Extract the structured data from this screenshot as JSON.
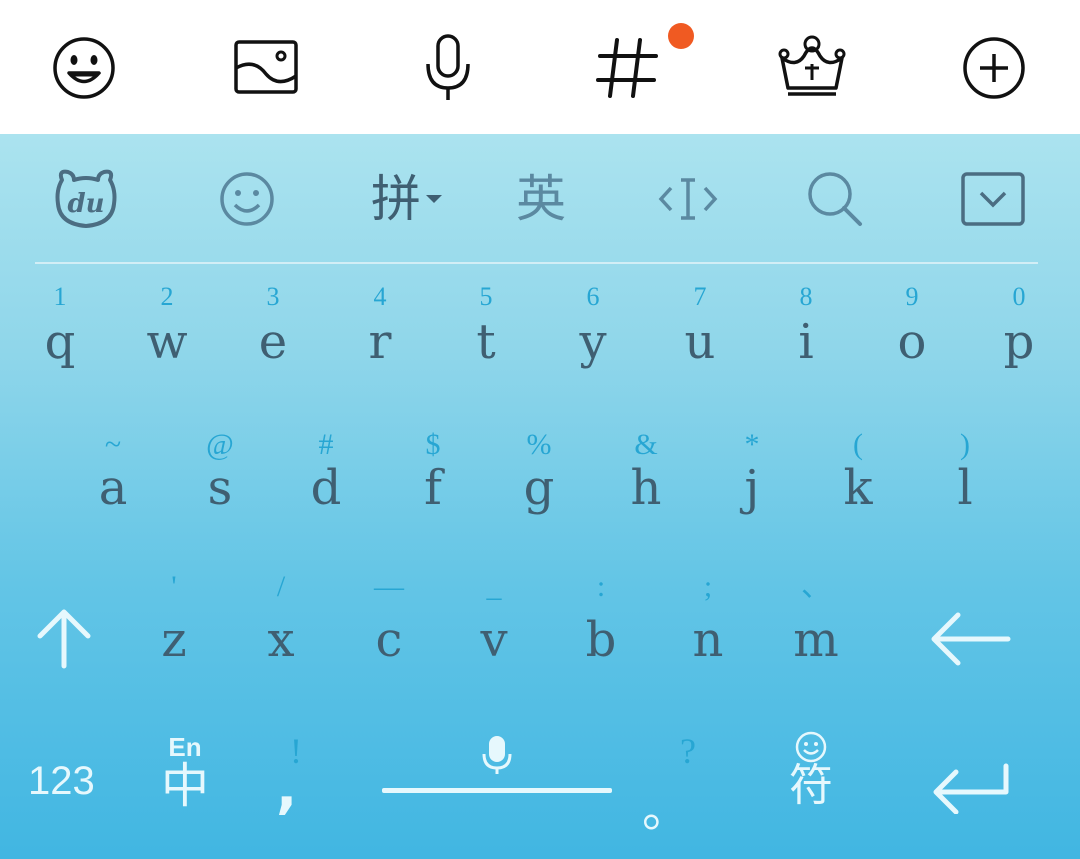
{
  "toolbar": {
    "icons": [
      "smiley-face-icon",
      "picture-icon",
      "microphone-icon",
      "hashtag-icon",
      "crown-icon",
      "plus-circle-icon"
    ],
    "accent_dot_color": "#f05a22"
  },
  "options_bar": {
    "logo_text": "du",
    "pinyin_label": "拼",
    "english_label": "英"
  },
  "keys": {
    "row1": [
      {
        "hint": "1",
        "main": "q"
      },
      {
        "hint": "2",
        "main": "w"
      },
      {
        "hint": "3",
        "main": "e"
      },
      {
        "hint": "4",
        "main": "r"
      },
      {
        "hint": "5",
        "main": "t"
      },
      {
        "hint": "6",
        "main": "y"
      },
      {
        "hint": "7",
        "main": "u"
      },
      {
        "hint": "8",
        "main": "i"
      },
      {
        "hint": "9",
        "main": "o"
      },
      {
        "hint": "0",
        "main": "p"
      }
    ],
    "row2": [
      {
        "hint": "~",
        "main": "a"
      },
      {
        "hint": "@",
        "main": "s"
      },
      {
        "hint": "#",
        "main": "d"
      },
      {
        "hint": "$",
        "main": "f"
      },
      {
        "hint": "%",
        "main": "g"
      },
      {
        "hint": "&",
        "main": "h"
      },
      {
        "hint": "*",
        "main": "j"
      },
      {
        "hint": "(",
        "main": "k"
      },
      {
        "hint": ")",
        "main": "l"
      }
    ],
    "row3": [
      {
        "hint": "'",
        "main": "z"
      },
      {
        "hint": "/",
        "main": "x"
      },
      {
        "hint": "—",
        "main": "c"
      },
      {
        "hint": "_",
        "main": "v"
      },
      {
        "hint": ":",
        "main": "b"
      },
      {
        "hint": ";",
        "main": "n"
      },
      {
        "hint": "、",
        "main": "m"
      }
    ]
  },
  "bottom_row": {
    "numbers_label": "123",
    "lang_small": "En",
    "lang_main": "中",
    "comma_hint": "!",
    "comma": ",",
    "period_hint": "?",
    "period": "。",
    "symbols_label": "符"
  },
  "colors": {
    "key_text": "#3f5f72",
    "hint_text": "#27a6d3",
    "function_key": "#e6f8fd"
  }
}
